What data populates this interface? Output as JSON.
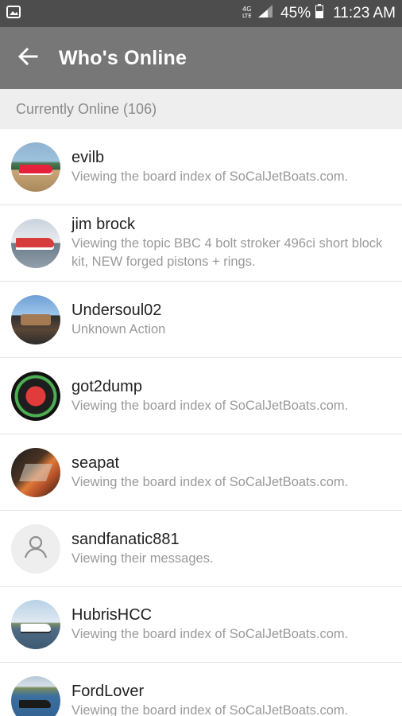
{
  "status_bar": {
    "lte": "4G LTE",
    "battery": "45%",
    "time": "11:23 AM"
  },
  "app_bar": {
    "title": "Who's Online"
  },
  "section": {
    "label": "Currently Online (106)"
  },
  "users": [
    {
      "name": "evilb",
      "action": "Viewing the board index of SoCalJetBoats.com.",
      "avatar": "boat-photo"
    },
    {
      "name": "jim brock",
      "action": "Viewing the topic BBC 4 bolt stroker 496ci short block kit, NEW forged pistons + rings.",
      "avatar": "boat-photo"
    },
    {
      "name": "Undersoul02",
      "action": "Unknown Action",
      "avatar": "boat-photo"
    },
    {
      "name": "got2dump",
      "action": "Viewing the board index of SoCalJetBoats.com.",
      "avatar": "logo-image"
    },
    {
      "name": "seapat",
      "action": "Viewing the board index of SoCalJetBoats.com.",
      "avatar": "boat-photo"
    },
    {
      "name": "sandfanatic881",
      "action": "Viewing their messages.",
      "avatar": "default-person-icon"
    },
    {
      "name": "HubrisHCC",
      "action": "Viewing the board index of SoCalJetBoats.com.",
      "avatar": "boat-photo"
    },
    {
      "name": "FordLover",
      "action": "Viewing the board index of SoCalJetBoats.com.",
      "avatar": "boat-photo"
    }
  ],
  "colors": {
    "status_bar": "#4d4d4d",
    "app_bar": "#777777",
    "section_header_bg": "#eeeeee",
    "name_text": "#222222",
    "action_text": "#9a9a9a"
  }
}
